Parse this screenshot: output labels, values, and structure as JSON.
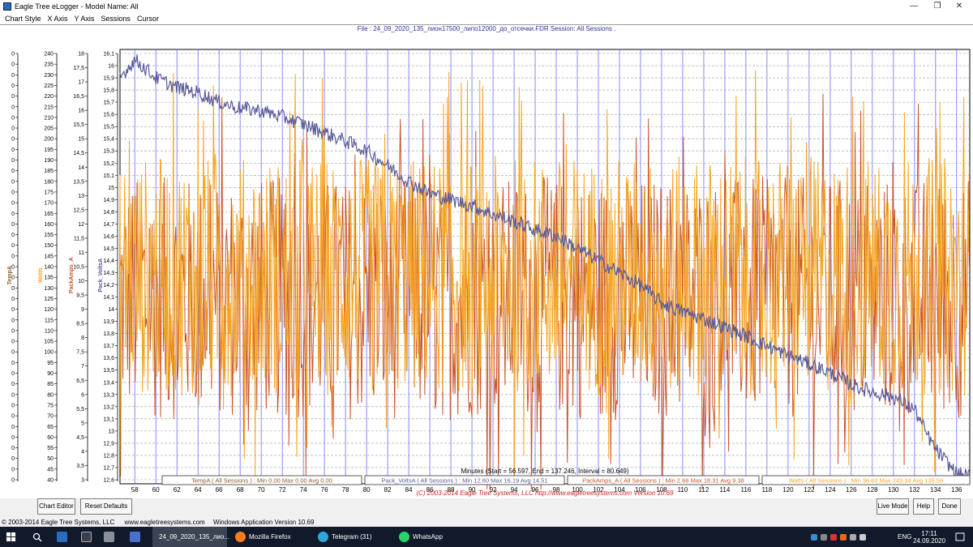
{
  "window": {
    "title": "Eagle Tree eLogger - Model Name: All",
    "minimize_glyph": "—",
    "maximize_glyph": "❐",
    "close_glyph": "✕"
  },
  "menu": {
    "chart_style": "Chart Style",
    "x_axis": "X Axis",
    "y_axis": "Y Axis",
    "sessions": "Sessions",
    "cursor": "Cursor"
  },
  "file_info": "File : 24_09_2020_135_лион17500_липо12000_до_отсечки.FDR   Session: All Sessions .",
  "chart_data": {
    "type": "line",
    "xlabel": "Minutes (Start = 56.597,  End = 137.246,  Interval =  80.649)",
    "xlim": [
      56.597,
      137.246
    ],
    "x_ticks": [
      58,
      60,
      62,
      64,
      66,
      68,
      70,
      72,
      74,
      76,
      78,
      80,
      82,
      84,
      86,
      88,
      90,
      92,
      94,
      96,
      98,
      100,
      102,
      104,
      106,
      108,
      110,
      112,
      114,
      116,
      118,
      120,
      122,
      124,
      126,
      128,
      130,
      132,
      134,
      136
    ],
    "grid": true,
    "y_axes": [
      {
        "label": "TempA",
        "color": "#8b5a2b",
        "ticks": [
          "0",
          "0",
          "0",
          "0",
          "0",
          "0",
          "0",
          "0",
          "0",
          "0",
          "0",
          "0",
          "0",
          "0",
          "0",
          "0",
          "0",
          "0",
          "0",
          "0",
          "0",
          "0",
          "0",
          "0",
          "0",
          "0",
          "0",
          "0",
          "0",
          "0",
          "0",
          "0",
          "0",
          "0",
          "0",
          "0",
          "0",
          "0",
          "0",
          "0",
          "0"
        ]
      },
      {
        "label": "Watts",
        "color": "#f5a623",
        "ylim": [
          40,
          240
        ],
        "ticks": [
          "240",
          "235",
          "230",
          "225",
          "220",
          "215",
          "210",
          "205",
          "200",
          "195",
          "190",
          "185",
          "180",
          "175",
          "170",
          "165",
          "160",
          "155",
          "150",
          "145",
          "140",
          "135",
          "130",
          "125",
          "120",
          "115",
          "110",
          "105",
          "100",
          "95",
          "90",
          "85",
          "80",
          "75",
          "70",
          "65",
          "60",
          "55",
          "50",
          "45",
          "40"
        ]
      },
      {
        "label": "PackAmps_A",
        "color": "#c8552b",
        "ylim": [
          3,
          18
        ],
        "ticks": [
          "18",
          "17,5",
          "17",
          "16,5",
          "16",
          "15,5",
          "15",
          "14,5",
          "14",
          "13,5",
          "13",
          "12,5",
          "12",
          "11,5",
          "11",
          "10,5",
          "10",
          "9,5",
          "9",
          "8,5",
          "8",
          "7,5",
          "7",
          "6,5",
          "6",
          "5,5",
          "5",
          "4,5",
          "4",
          "3,5",
          "3"
        ]
      },
      {
        "label": "Pack_VoltsA",
        "color": "#5a5a9a",
        "ylim": [
          12.6,
          16.1
        ],
        "ticks": [
          "16,1",
          "16",
          "15,9",
          "15,8",
          "15,7",
          "15,6",
          "15,5",
          "15,4",
          "15,3",
          "15,2",
          "15,1",
          "15",
          "14,9",
          "14,8",
          "14,7",
          "14,6",
          "14,5",
          "14,4",
          "14,3",
          "14,2",
          "14,1",
          "14",
          "13,9",
          "13,8",
          "13,7",
          "13,6",
          "13,5",
          "13,4",
          "13,3",
          "13,2",
          "13,1",
          "13",
          "12,9",
          "12,8",
          "12,7",
          "12,6"
        ]
      }
    ],
    "series": [
      {
        "name": "Pack_VoltsA",
        "color": "#5a5a9a",
        "axis": "Pack_VoltsA",
        "x": [
          56.6,
          58,
          60,
          62,
          64,
          66,
          68,
          70,
          72,
          74,
          76,
          78,
          80,
          82,
          84,
          86,
          88,
          90,
          92,
          94,
          96,
          98,
          100,
          102,
          104,
          106,
          108,
          110,
          112,
          114,
          116,
          118,
          120,
          122,
          124,
          126,
          128,
          130,
          132,
          133,
          134,
          135,
          136,
          137.2
        ],
        "y": [
          15.9,
          16.05,
          15.9,
          15.82,
          15.78,
          15.7,
          15.65,
          15.63,
          15.58,
          15.52,
          15.45,
          15.38,
          15.3,
          15.18,
          15.05,
          14.95,
          14.9,
          14.85,
          14.78,
          14.72,
          14.65,
          14.6,
          14.5,
          14.4,
          14.3,
          14.2,
          14.05,
          13.98,
          13.92,
          13.85,
          13.78,
          13.7,
          13.62,
          13.55,
          13.48,
          13.38,
          13.32,
          13.28,
          13.18,
          13.0,
          12.85,
          12.75,
          12.65,
          12.63
        ]
      },
      {
        "name": "PackAmps_A",
        "color": "#c8552b",
        "axis": "PackAmps_A",
        "x": [
          56.6,
          137.2
        ],
        "y_min": 2.66,
        "y_max": 18.31,
        "y_avg": 9.38
      },
      {
        "name": "Watts",
        "color": "#f5a623",
        "axis": "Watts",
        "x": [
          56.6,
          137.2
        ],
        "y_min": 38.6,
        "y_max": 243.34,
        "y_avg": 135.56
      }
    ],
    "legend": [
      {
        "text": "TempA ( All Sessions ) : Min 0.00   Max 0.00   Avg 0.00",
        "color": "#8b5a2b"
      },
      {
        "text": "Pack_VoltsA ( All Sessions ) : Min 12.60   Max 16.19   Avg 14.51",
        "color": "#5a5a9a"
      },
      {
        "text": "PackAmps_A ( All Sessions ) : Min 2.66   Max 18.31   Avg 9.38",
        "color": "#c8552b"
      },
      {
        "text": "Watts ( All Sessions ) : Min 38.60   Max 243.34   Avg 135.56",
        "color": "#f5a623"
      }
    ],
    "copyright": "(C) 2003-2014 Eagle Tree Systems, LLC  http://www.eagletreesystems.com  Version 10.69"
  },
  "buttons": {
    "chart_editor": "Chart Editor",
    "reset_defaults": "Reset Defaults",
    "live_mode": "Live Mode",
    "help": "Help",
    "done": "Done"
  },
  "status": {
    "company": "© 2003-2014 Eagle Tree Systems, LLC",
    "website": "www.eagletreesystems.com",
    "version": "Windows Application Version 10.69"
  },
  "taskbar": {
    "active_app": "24_09_2020_135_лио...",
    "firefox": "Mozilla Firefox",
    "telegram": "Telegram (31)",
    "whatsapp": "WhatsApp",
    "language": "ENG",
    "time": "17:11",
    "date": "24.09.2020"
  }
}
